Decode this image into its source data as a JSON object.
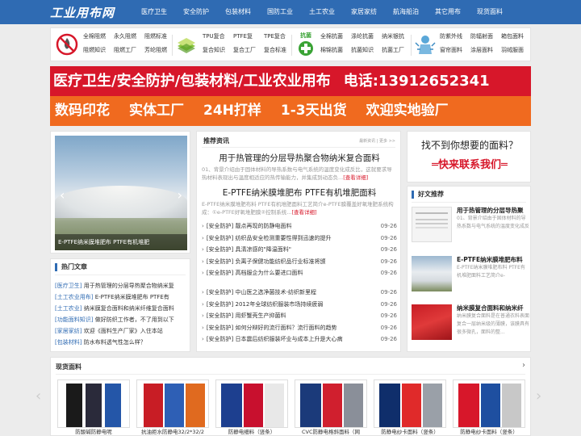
{
  "logo": "工业用布网",
  "nav": [
    "医疗卫生",
    "安全防护",
    "包装材料",
    "国防工业",
    "土工农业",
    "家居家纺",
    "航海船泊",
    "其它用布",
    "现货面料"
  ],
  "categories": {
    "group1": [
      "全棉阻燃",
      "永久阻燃",
      "阻燃标准",
      "阻燃知识",
      "阻燃工厂",
      "芳纶阻燃"
    ],
    "group2": [
      "TPU复合",
      "PTFE复",
      "TPE复合",
      "复合知识",
      "复合工厂",
      "复合标准"
    ],
    "group3_icon_label": "抗菌",
    "group3": [
      "全棉抗菌",
      "涤纶抗菌",
      "纳米银抗",
      "棉锦抗菌",
      "抗菌知识",
      "抗菌工厂"
    ],
    "group4": [
      "防紫外线",
      "防辐射面",
      "箱包面料",
      "窗帘面料",
      "涂层面料",
      "羽绒服面"
    ]
  },
  "banner": {
    "line1": "医疗卫生/安全防护/包装材料/工业农业用布",
    "phone": "电话:13912652341",
    "line2": [
      "数码印花",
      "实体工厂",
      "24H打样",
      "1-3天出货",
      "欢迎实地验厂"
    ]
  },
  "slider": {
    "caption": "E-PTFE纳米膜堆肥布 PTFE有机堆肥"
  },
  "hot": {
    "title": "热门文章",
    "items": [
      {
        "tag": "[医疗卫生]",
        "text": "用于热管理的分层导热聚合物纳米复"
      },
      {
        "tag": "[土工农业用布]",
        "text": "E-PTFE纳米膜堆肥布 PTFE有"
      },
      {
        "tag": "[土工农业]",
        "text": "纳米膜复合面料和纳米纤维复合面料"
      },
      {
        "tag": "[功能面料知识]",
        "text": "做好防织工作者，不了用到以下"
      },
      {
        "tag": "[家居家纺]",
        "text": "欢迎《面料生产厂家》入住本站"
      },
      {
        "tag": "[包装材料]",
        "text": "防水布料透气性怎么样？"
      }
    ]
  },
  "news": {
    "title": "推荐资讯",
    "more": "最新资讯 | 更多 >>",
    "head1": {
      "title": "用于热管理的分层导热聚合物纳米复合面料",
      "desc": "01、背景介绍由于固体材料的导热系数与电气系统的温度变化成反比，这就要求导热材料表现出与温度相适应的热传输能力，并集成到动态负...",
      "more": "[查看详细]"
    },
    "head2": {
      "title": "E-PTFE纳米膜堆肥布 PTFE有机堆肥面料",
      "desc": "E-PTFE纳米膜堆肥布料 PTFE有机堆肥面料工艺简介e-PTFE膜覆盖好氧堆肥系统构成：①e-PTFE好氧堆肥膜②控制系统...",
      "more": "[查看详细]"
    },
    "list1": [
      {
        "text": "[安全防护] 靓点再现的防静电面料",
        "date": "09-26"
      },
      {
        "text": "[安全防护] 纺织品安全检测重要性得到迅速的提升",
        "date": "09-26"
      },
      {
        "text": "[安全防护] 具清凉感的\"降温面料\"",
        "date": "09-26"
      },
      {
        "text": "[安全防护] 负离子保健功能纺织品行业标准将颁",
        "date": "09-26"
      },
      {
        "text": "[安全防护] 高档服企为什么要进口面料",
        "date": "09-26"
      }
    ],
    "list2": [
      {
        "text": "[安全防护] 中山医之选净菌技术-纺织新里程",
        "date": "09-26"
      },
      {
        "text": "[安全防护] 2012年全球纺织服装市场持续疲弱",
        "date": "09-26"
      },
      {
        "text": "[安全防护] 用虾蟹壳生产抑菌料",
        "date": "09-26"
      },
      {
        "text": "[安全防护] 如何分辩好的流行面料？流行面料的趋势",
        "date": "09-26"
      },
      {
        "text": "[安全防护] 日本震后纺织服装坏业与成本上升是大心病",
        "date": "09-26"
      }
    ]
  },
  "contact": {
    "question": "找不到你想要的面料？",
    "answer": "═快来联系我们═"
  },
  "recommend": {
    "title": "好文推荐",
    "items": [
      {
        "title": "用于热管理的分层导热聚",
        "desc": "01、背景介绍由于固体材料的导热系数与电气系统的温度变化成反"
      },
      {
        "title": "E-PTFE纳米膜堆肥布料",
        "desc": "E-PTFE纳米膜堆肥布料 PTFE有机堆肥面料工艺简介e-"
      },
      {
        "title": "纳米膜复合面料和纳米纤",
        "desc": "纳米膜复合面料是在普通衣料表面复合一层纳米级的薄膜，该膜具有很多微孔，面料的整..."
      }
    ]
  },
  "products": {
    "title": "现货面料",
    "items": [
      {
        "caption": "防酸碱防静电呢"
      },
      {
        "caption": "抗油拒水防静电32/2*32/2"
      },
      {
        "caption": "防静电细料（竖条）"
      },
      {
        "caption": "CVC防静电格斜面料（网"
      },
      {
        "caption": "防静电纱卡面料（竖条）"
      },
      {
        "caption": "防静电纱卡面料（竖条）"
      }
    ]
  },
  "colors": {
    "nav_blue": "#2f6bb3",
    "banner_red": "#d7172a",
    "banner_orange": "#f06a1f"
  }
}
